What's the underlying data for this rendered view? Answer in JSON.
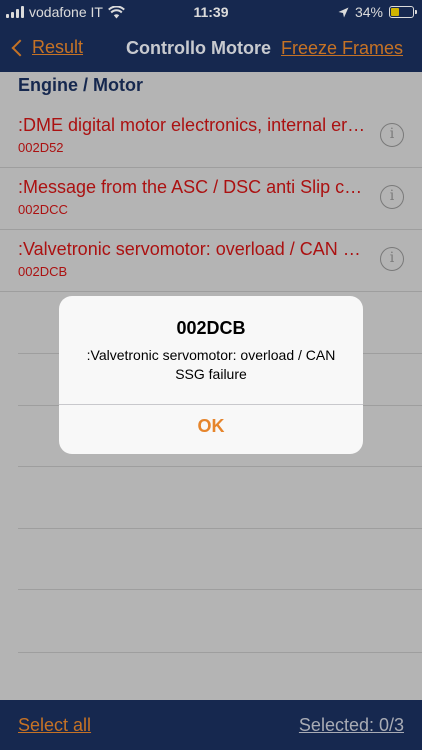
{
  "status_bar": {
    "carrier": "vodafone IT",
    "time": "11:39",
    "battery_percent_label": "34%",
    "battery_level": 0.34,
    "battery_color": "#f3d200"
  },
  "nav_bar": {
    "back_label": "Result",
    "title": "Controllo Motore",
    "right_label": "Freeze Frames"
  },
  "section": {
    "header": "Engine / Motor",
    "items": [
      {
        "title": ":DME digital motor electronics, internal error",
        "code": "002D52"
      },
      {
        "title": ":Message from the ASC / DSC anti Slip control",
        "code": "002DCC"
      },
      {
        "title": ":Valvetronic servomotor: overload / CAN SSG failure",
        "code": "002DCB"
      }
    ]
  },
  "toolbar": {
    "select_all": "Select all",
    "selected_label": "Selected:  0/3"
  },
  "alert": {
    "title": "002DCB",
    "message": ":Valvetronic servomotor: overload / CAN SSG failure",
    "button": "OK"
  },
  "colors": {
    "bar_background": "#1a2f5c",
    "accent": "#e6852c",
    "error_text": "#c81414"
  }
}
